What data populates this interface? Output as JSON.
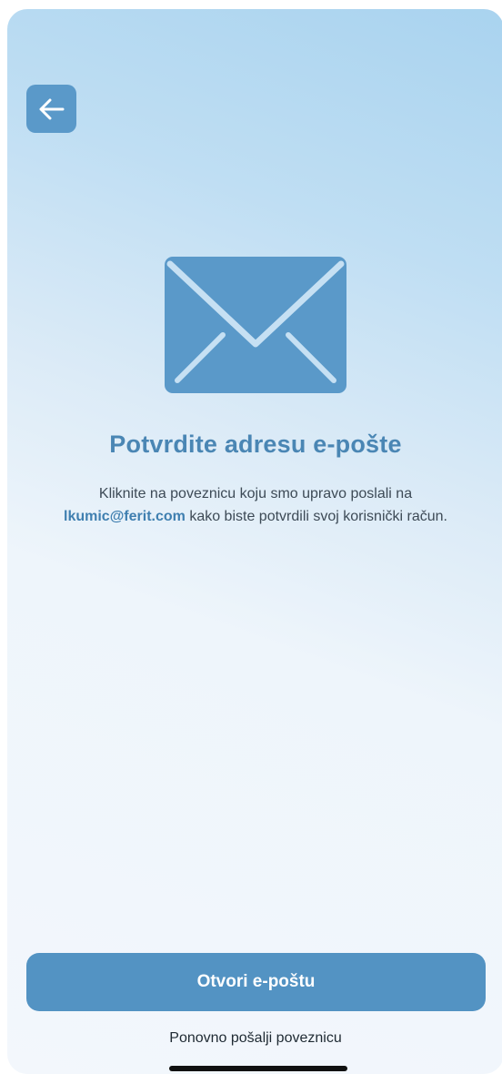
{
  "colors": {
    "accent": "#5393C3",
    "title": "#4A86B4",
    "text": "#3D4A56",
    "link": "#1F2A33"
  },
  "header": {
    "back_icon": "arrow-left-icon"
  },
  "hero": {
    "icon": "envelope-icon"
  },
  "content": {
    "title": "Potvrdite adresu e-pošte",
    "desc_before": "Kliknite na poveznicu koju smo upravo poslali na",
    "email": "lkumic@ferit.com",
    "desc_after": "kako biste potvrdili svoj korisnički račun."
  },
  "actions": {
    "primary_label": "Otvori e-poštu",
    "secondary_label": "Ponovno pošalji poveznicu"
  }
}
